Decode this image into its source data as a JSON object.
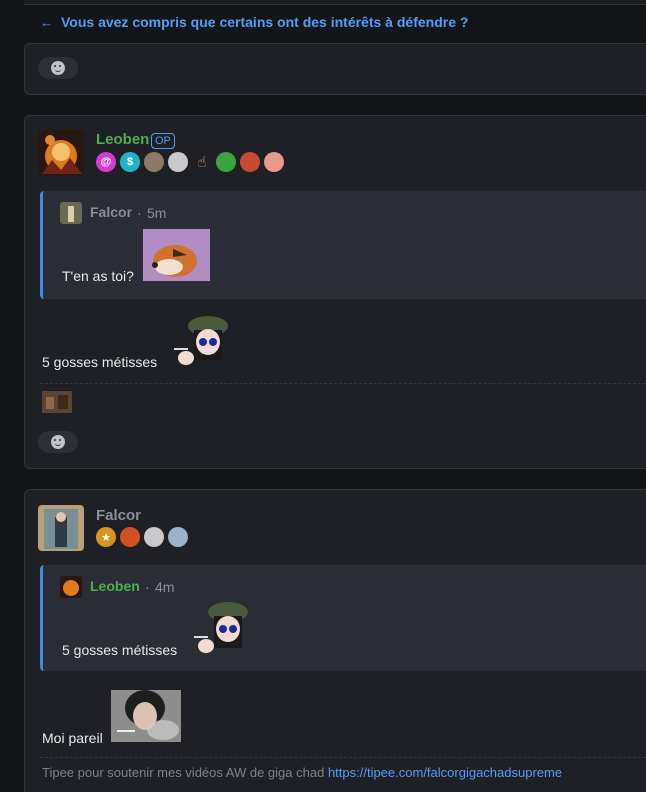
{
  "thread": {
    "reply_title": "Vous avez compris que certains ont des intérêts à défendre ?"
  },
  "posts": [
    {
      "author": "Leoben",
      "op_label": "OP",
      "badges": [
        "swirl-badge",
        "dollar-badge",
        "portrait-badge",
        "old-man-badge",
        "hand-badge",
        "beer-badge",
        "cup-badge",
        "anime-badge"
      ],
      "quote": {
        "author": "Falcor",
        "time": "5m",
        "text": "T'en as toi?"
      },
      "text": "5 gosses métisses"
    },
    {
      "author": "Falcor",
      "badges": [
        "star-badge",
        "mushroom-badge",
        "old-man-badge",
        "anime-badge"
      ],
      "quote": {
        "author": "Leoben",
        "time": "4m",
        "text": "5 gosses métisses"
      },
      "text": "Moi pareil",
      "signature_text": "Tipee pour soutenir mes vidéos AW de giga chad",
      "signature_link": "https://tipee.com/falcorgigachadsupreme"
    }
  ],
  "colors": {
    "background": "#141519",
    "card": "#1e2026",
    "accent_blue": "#4f9ef8",
    "author_green": "#4caf50",
    "quote_border": "#3b8be6"
  },
  "separator": "·"
}
